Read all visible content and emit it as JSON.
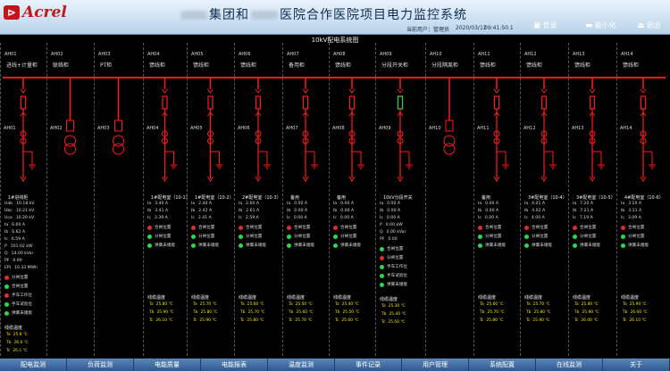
{
  "header": {
    "logo_text": "Acrel",
    "title_part1": "集团和",
    "title_part2": "医院合作医院项目电力监控系统",
    "user_label": "当前用户：",
    "user_name": "管理员",
    "date": "2020/03/12",
    "time": "09:41:50.1",
    "buttons": [
      {
        "label": "登录",
        "icon": "login-icon"
      },
      {
        "label": "最小化",
        "icon": "minimize-icon"
      },
      {
        "label": "退出",
        "icon": "exit-icon"
      }
    ]
  },
  "diagram": {
    "title": "10kV配电系统图",
    "panels": [
      {
        "code": "AH01",
        "name": "进线+计量柜",
        "cab": "AH01",
        "ctitle": "1#进线柜",
        "meas": [
          [
            "Uab",
            "10.18 kV"
          ],
          [
            "Ubc",
            "10.21 kV"
          ],
          [
            "Uca",
            "10.20 kV"
          ],
          [
            "Ia",
            "6.60 A"
          ],
          [
            "Ib",
            "6.62 A"
          ],
          [
            "Ic",
            "6.59 A"
          ],
          [
            "P",
            "101.02 kW"
          ],
          [
            "Q",
            "14.00 kVar"
          ],
          [
            "PF",
            "0.99"
          ],
          [
            "EPI",
            "10.33 MWh"
          ]
        ],
        "status": [
          [
            "分闸位置",
            "r"
          ],
          [
            "合闸位置",
            "g"
          ],
          [
            "手车工作位",
            "r"
          ],
          [
            "手车试验位",
            "g"
          ],
          [
            "弹簧未储能",
            "g"
          ]
        ],
        "ttitle": "线缆温度",
        "temps": [
          [
            "Ta",
            "25.8 ℃"
          ],
          [
            "Tb",
            "26.0 ℃"
          ],
          [
            "Tc",
            "26.1 ℃"
          ]
        ]
      },
      {
        "code": "AH02",
        "name": "联络柜",
        "cab": "AH02",
        "ctitle": "",
        "meas": [],
        "status": [],
        "ttitle": "",
        "temps": []
      },
      {
        "code": "AH03",
        "name": "PT柜",
        "cab": "AH03",
        "ctitle": "",
        "meas": [],
        "status": [],
        "ttitle": "",
        "temps": []
      },
      {
        "code": "AH04",
        "name": "馈线柜",
        "cab": "AH04",
        "ctitle": "1#配电室（10-1）",
        "meas": [
          [
            "Ia",
            "3.40 A"
          ],
          [
            "Ib",
            "3.41 A"
          ],
          [
            "Ic",
            "3.39 A"
          ]
        ],
        "status": [
          [
            "合闸位置",
            "r"
          ],
          [
            "分闸位置",
            "g"
          ],
          [
            "弹簧未储能",
            "g"
          ]
        ],
        "ttitle": "线缆温度",
        "temps": [
          [
            "Ta",
            "25.80 ℃"
          ],
          [
            "Tb",
            "25.90 ℃"
          ],
          [
            "Tc",
            "26.10 ℃"
          ]
        ]
      },
      {
        "code": "AH05",
        "name": "馈线柜",
        "cab": "AH05",
        "ctitle": "1#配电室（10-2）",
        "meas": [
          [
            "Ia",
            "2.40 A"
          ],
          [
            "Ib",
            "2.42 A"
          ],
          [
            "Ic",
            "2.41 A"
          ]
        ],
        "status": [
          [
            "合闸位置",
            "r"
          ],
          [
            "分闸位置",
            "g"
          ],
          [
            "弹簧未储能",
            "g"
          ]
        ],
        "ttitle": "线缆温度",
        "temps": [
          [
            "Ta",
            "25.70 ℃"
          ],
          [
            "Tb",
            "25.80 ℃"
          ],
          [
            "Tc",
            "25.90 ℃"
          ]
        ]
      },
      {
        "code": "AH06",
        "name": "馈线柜",
        "cab": "AH06",
        "ctitle": "2#配电室（10-3）",
        "meas": [
          [
            "Ia",
            "2.60 A"
          ],
          [
            "Ib",
            "2.61 A"
          ],
          [
            "Ic",
            "2.59 A"
          ]
        ],
        "status": [
          [
            "合闸位置",
            "r"
          ],
          [
            "分闸位置",
            "g"
          ],
          [
            "弹簧未储能",
            "g"
          ]
        ],
        "ttitle": "线缆温度",
        "temps": [
          [
            "Ta",
            "25.60 ℃"
          ],
          [
            "Tb",
            "25.70 ℃"
          ],
          [
            "Tc",
            "25.80 ℃"
          ]
        ]
      },
      {
        "code": "AH07",
        "name": "备用柜",
        "cab": "AH07",
        "ctitle": "备用",
        "meas": [
          [
            "Ia",
            "0.00 A"
          ],
          [
            "Ib",
            "0.00 A"
          ],
          [
            "Ic",
            "0.00 A"
          ]
        ],
        "status": [
          [
            "合闸位置",
            "r"
          ],
          [
            "分闸位置",
            "g"
          ],
          [
            "弹簧未储能",
            "g"
          ]
        ],
        "ttitle": "线缆温度",
        "temps": [
          [
            "Ta",
            "25.50 ℃"
          ],
          [
            "Tb",
            "25.60 ℃"
          ],
          [
            "Tc",
            "25.70 ℃"
          ]
        ]
      },
      {
        "code": "AH08",
        "name": "馈线柜",
        "cab": "AH08",
        "ctitle": "备用",
        "meas": [
          [
            "Ia",
            "0.00 A"
          ],
          [
            "Ib",
            "0.00 A"
          ],
          [
            "Ic",
            "0.00 A"
          ]
        ],
        "status": [
          [
            "合闸位置",
            "r"
          ],
          [
            "分闸位置",
            "g"
          ],
          [
            "弹簧未储能",
            "g"
          ]
        ],
        "ttitle": "线缆温度",
        "temps": [
          [
            "Ta",
            "25.40 ℃"
          ],
          [
            "Tb",
            "25.50 ℃"
          ],
          [
            "Tc",
            "25.60 ℃"
          ]
        ]
      },
      {
        "code": "AH09",
        "name": "分段开关柜",
        "cab": "AH09",
        "ctitle": "10kV分段开关",
        "meas": [
          [
            "Ia",
            "0.00 A"
          ],
          [
            "Ib",
            "0.00 A"
          ],
          [
            "Ic",
            "0.00 A"
          ],
          [
            "P",
            "0.00 kW"
          ],
          [
            "Q",
            "0.00 kVar"
          ],
          [
            "PF",
            "0.00"
          ]
        ],
        "status": [
          [
            "合闸位置",
            "g"
          ],
          [
            "分闸位置",
            "r"
          ],
          [
            "手车工作位",
            "g"
          ],
          [
            "手车试验位",
            "g"
          ],
          [
            "弹簧未储能",
            "g"
          ]
        ],
        "ttitle": "线缆温度",
        "temps": [
          [
            "Ta",
            "25.30 ℃"
          ],
          [
            "Tb",
            "25.40 ℃"
          ],
          [
            "Tc",
            "25.50 ℃"
          ]
        ]
      },
      {
        "code": "AH10",
        "name": "分段隔离柜",
        "cab": "AH10",
        "ctitle": "",
        "meas": [],
        "status": [],
        "ttitle": "",
        "temps": []
      },
      {
        "code": "AH11",
        "name": "馈线柜",
        "cab": "AH11",
        "ctitle": "备用",
        "meas": [
          [
            "Ia",
            "0.00 A"
          ],
          [
            "Ib",
            "0.00 A"
          ],
          [
            "Ic",
            "0.00 A"
          ]
        ],
        "status": [
          [
            "合闸位置",
            "r"
          ],
          [
            "分闸位置",
            "g"
          ],
          [
            "弹簧未储能",
            "g"
          ]
        ],
        "ttitle": "线缆温度",
        "temps": [
          [
            "Ta",
            "25.60 ℃"
          ],
          [
            "Tb",
            "25.70 ℃"
          ],
          [
            "Tc",
            "25.80 ℃"
          ]
        ]
      },
      {
        "code": "AH12",
        "name": "馈线柜",
        "cab": "AH12",
        "ctitle": "3#配电室（10-4）",
        "meas": [
          [
            "Ia",
            "4.01 A"
          ],
          [
            "Ib",
            "4.02 A"
          ],
          [
            "Ic",
            "4.00 A"
          ]
        ],
        "status": [
          [
            "合闸位置",
            "r"
          ],
          [
            "分闸位置",
            "g"
          ],
          [
            "弹簧未储能",
            "g"
          ]
        ],
        "ttitle": "线缆温度",
        "temps": [
          [
            "Ta",
            "25.70 ℃"
          ],
          [
            "Tb",
            "25.80 ℃"
          ],
          [
            "Tc",
            "25.90 ℃"
          ]
        ]
      },
      {
        "code": "AH13",
        "name": "馈线柜",
        "cab": "AH13",
        "ctitle": "3#配电室（10-5）",
        "meas": [
          [
            "Ia",
            "7.20 A"
          ],
          [
            "Ib",
            "7.21 A"
          ],
          [
            "Ic",
            "7.19 A"
          ]
        ],
        "status": [
          [
            "合闸位置",
            "r"
          ],
          [
            "分闸位置",
            "g"
          ],
          [
            "弹簧未储能",
            "g"
          ]
        ],
        "ttitle": "线缆温度",
        "temps": [
          [
            "Ta",
            "25.80 ℃"
          ],
          [
            "Tb",
            "25.90 ℃"
          ],
          [
            "Tc",
            "26.00 ℃"
          ]
        ]
      },
      {
        "code": "AH14",
        "name": "馈线柜",
        "cab": "AH14",
        "ctitle": "4#配电室（10-6）",
        "meas": [
          [
            "Ia",
            "3.10 A"
          ],
          [
            "Ib",
            "3.11 A"
          ],
          [
            "Ic",
            "3.09 A"
          ]
        ],
        "status": [
          [
            "合闸位置",
            "r"
          ],
          [
            "分闸位置",
            "g"
          ],
          [
            "弹簧未储能",
            "g"
          ]
        ],
        "ttitle": "线缆温度",
        "temps": [
          [
            "Ta",
            "25.90 ℃"
          ],
          [
            "Tb",
            "26.00 ℃"
          ],
          [
            "Tc",
            "26.10 ℃"
          ]
        ]
      }
    ]
  },
  "toolbar": [
    "配电监测",
    "负荷监测",
    "电能质量",
    "电能报表",
    "温度监测",
    "事件记录",
    "用户管理",
    "系统配置",
    "在线监测",
    "关于"
  ],
  "colors": {
    "closed": "#e12b2b",
    "open": "#2bd74b",
    "busbar": "#ff1a1a",
    "temp_text": "#f2e200"
  }
}
